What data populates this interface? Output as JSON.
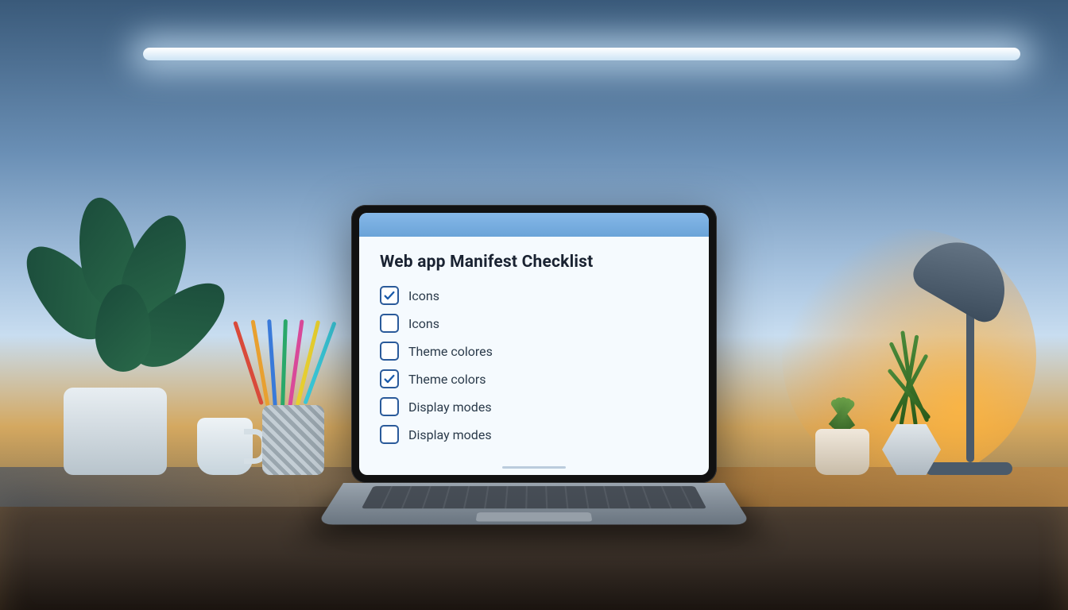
{
  "checklist": {
    "title": "Web app Manifest Checklist",
    "items": [
      {
        "label": "Icons",
        "checked": true
      },
      {
        "label": "Icons",
        "checked": false
      },
      {
        "label": "Theme colores",
        "checked": false
      },
      {
        "label": "Theme colors",
        "checked": true
      },
      {
        "label": "Display modes",
        "checked": false
      },
      {
        "label": "Display modes",
        "checked": false
      }
    ]
  }
}
